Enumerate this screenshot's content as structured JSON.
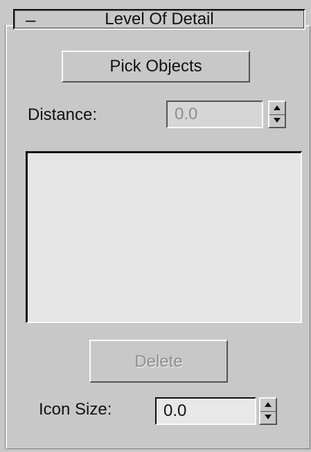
{
  "rollout": {
    "toggle": "–",
    "title": "Level Of Detail"
  },
  "pick_objects": {
    "label": "Pick Objects"
  },
  "distance": {
    "label": "Distance:",
    "value": "0.0",
    "enabled": false
  },
  "lod_list": {
    "items": []
  },
  "delete": {
    "label": "Delete",
    "enabled": false
  },
  "icon_size": {
    "label": "Icon Size:",
    "value": "0.0",
    "enabled": true
  }
}
